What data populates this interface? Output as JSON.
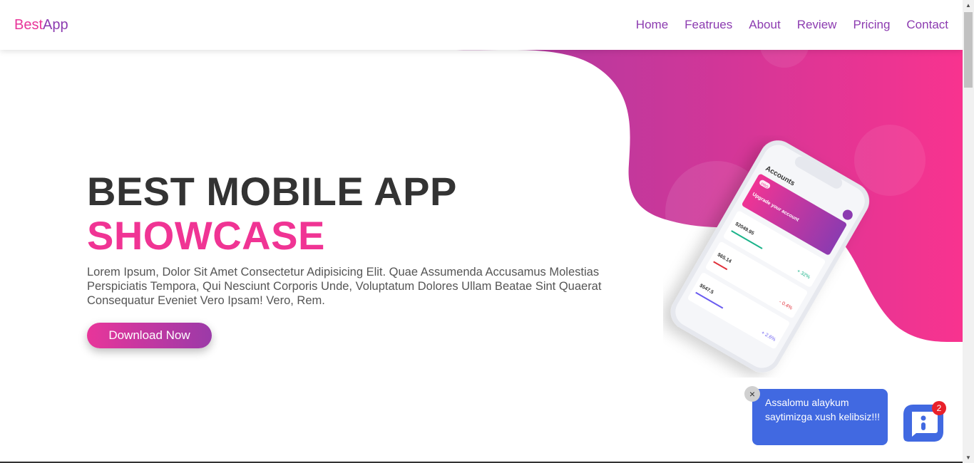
{
  "header": {
    "logo_part1": "Best",
    "logo_part2": "App",
    "nav": [
      "Home",
      "Featrues",
      "About",
      "Review",
      "Pricing",
      "Contact"
    ]
  },
  "hero": {
    "title_line1": "BEST MOBILE APP",
    "title_line2": "SHOWCASE",
    "description": "Lorem Ipsum, Dolor Sit Amet Consectetur Adipisicing Elit. Quae Assumenda Accusamus Molestias Perspiciatis Tempora, Qui Nesciunt Corporis Unde, Voluptatum Dolores Ullam Beatae Sint Quaerat Consequatur Eveniet Vero Ipsam! Vero, Rem.",
    "download_label": "Download Now"
  },
  "phone": {
    "title": "Accounts",
    "banner_tag": "PRO",
    "banner_text": "Upgrade your account",
    "cards": [
      {
        "amount": "$2049.95",
        "change": "+ 32%"
      },
      {
        "amount": "$65.14",
        "change": "- 0.4%"
      },
      {
        "amount": "$547.5",
        "change": "+ 2.6%"
      }
    ]
  },
  "chat": {
    "message": "Assalomu alaykum saytimizga xush kelibsiz!!!",
    "badge_count": "2",
    "close_icon": "×"
  },
  "colors": {
    "pink": "#f03494",
    "purple": "#8c3bb0",
    "chat_blue": "#4169e1"
  }
}
